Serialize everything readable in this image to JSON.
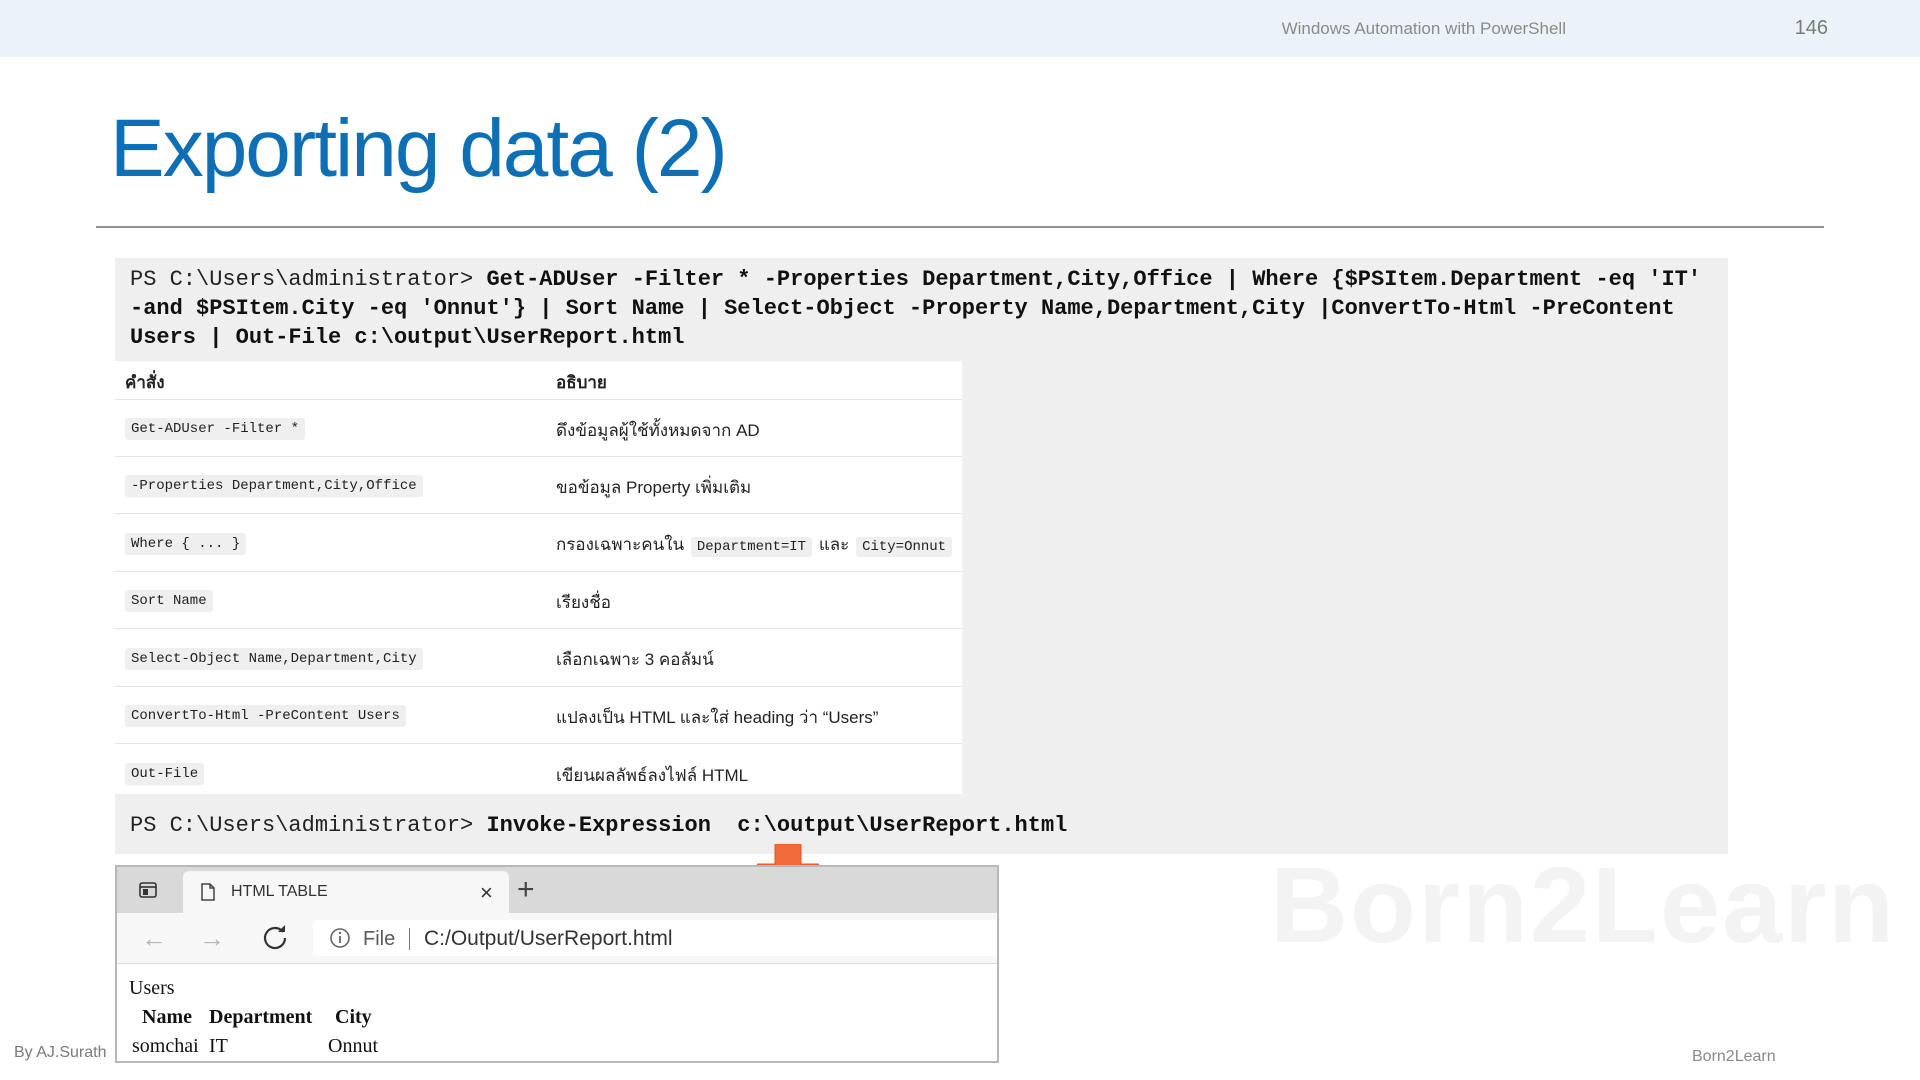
{
  "header": {
    "subject": "Windows Automation with PowerShell",
    "page_number": "146"
  },
  "slide_title": "Exporting data (2)",
  "watermark": "Born2Learn",
  "command1": {
    "prompt": "PS C:\\Users\\administrator> ",
    "text": "Get-ADUser -Filter * -Properties Department,City,Office | Where {$PSItem.Department -eq 'IT' -and $PSItem.City -eq 'Onnut'} | Sort Name | Select-Object -Property Name,Department,City |ConvertTo-Html -PreContent Users | Out-File c:\\output\\UserReport.html"
  },
  "table": {
    "headers": [
      "คำสั่ง",
      "อธิบาย"
    ],
    "rows": [
      {
        "command": "Get-ADUser -Filter *",
        "description": "ดึงข้อมูลผู้ใช้ทั้งหมดจาก AD"
      },
      {
        "command": "-Properties Department,City,Office",
        "description": "ขอข้อมูล Property เพิ่มเติม"
      },
      {
        "command": "Where { ... }",
        "description_prefix": "กรองเฉพาะคนใน",
        "description_code1": "Department=IT",
        "description_mid": "และ",
        "description_code2": "City=Onnut"
      },
      {
        "command": "Sort Name",
        "description": "เรียงชื่อ"
      },
      {
        "command": "Select-Object Name,Department,City",
        "description": "เลือกเฉพาะ 3 คอลัมน์"
      },
      {
        "command": "ConvertTo-Html -PreContent Users",
        "description": "แปลงเป็น HTML และใส่ heading ว่า “Users”"
      },
      {
        "command": "Out-File",
        "description": "เขียนผลลัพธ์ลงไฟล์ HTML"
      }
    ]
  },
  "command2": {
    "prompt": "PS C:\\Users\\administrator> ",
    "text": "Invoke-Expression  c:\\output\\UserReport.html"
  },
  "browser": {
    "tab_title": "HTML TABLE",
    "close_glyph": "×",
    "newtab_glyph": "+",
    "back_glyph": "←",
    "forward_glyph": "→",
    "address_scheme": "File",
    "url": "C:/Output/UserReport.html",
    "page": {
      "heading": "Users",
      "columns": [
        "Name",
        "Department",
        "City"
      ],
      "row": [
        "somchai",
        "IT",
        "Onnut"
      ]
    }
  },
  "footer": {
    "author": "By AJ.Surath",
    "brand": "Born2Learn"
  },
  "colors": {
    "title": "#0e6fb5",
    "topbar": "#eaf4f8",
    "arrow": "#f26b3a"
  }
}
